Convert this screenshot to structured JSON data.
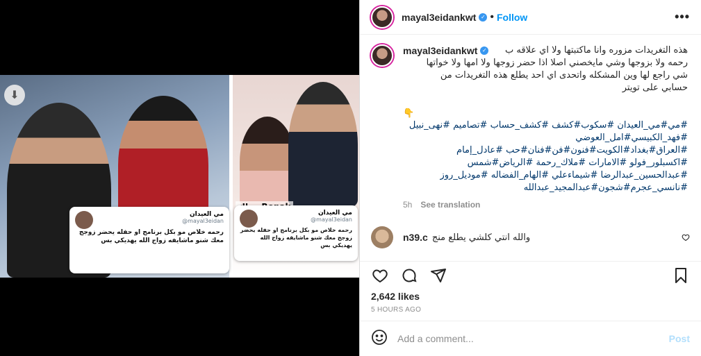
{
  "post": {
    "username": "mayal3eidankwt",
    "follow_label": "Follow",
    "dot": "•",
    "more": "•••",
    "caption_lines": [
      "هذه التغريدات مزوره وانا ماكتبتها ولا اي علاقه ب",
      "رحمه ولا بزوجها وشي مايخصني اصلا اذا حضر زوجها ولا امها ولا خواتها",
      "شي راجع لها وين المشكله واتحدى اي احد يطلع هذه التغريدات من",
      "حسابي على تويتر"
    ],
    "emoji": "👇",
    "hashtag_lines": [
      "#مي#مي_العيدان #سكوب#كشف #كشف_حساب #تصاميم #نهى_نبيل",
      "#فهد_الكبيسي#امل_العوضي",
      "#العراق#بغداد#الكويت#فنون#فن#فنان#حب #عادل_إمام",
      "#اكسبلور_فولو #الامارات #ملاك_رحمة #الرياض#شمس",
      "#عبدالحسين_عبدالرضا #شيماءعلي #الهام_الفضاله #موديل_روز",
      "#نانسي_عجرم#شجون#عبدالمجيد_عبدالله"
    ],
    "time": "5h",
    "see_translation": "See translation",
    "comment": {
      "user": "n39.c",
      "text": "والله انتي كلشي يطلع منج"
    },
    "likes": "2,642 likes",
    "ago": "5 HOURS AGO",
    "add_comment_placeholder": "Add a comment...",
    "post_label": "Post"
  },
  "media": {
    "card_left": {
      "name": "مي العيدان",
      "handle": "@mayal3eidan",
      "text": "رحمه خلاص مو بكل برنامج او حفله يحضر زوجج معك شنو ماشايفه زواج الله يهديكي بس"
    },
    "card_right": {
      "name": "مي العيدان",
      "handle": "@mayal3eidan",
      "text": "رحمه خلاص مو بكل برنامج او حفله يحضر زوجج معك شنو ماشايفه زواج الله يهديكي بس"
    },
    "brand": "روناكRonak"
  }
}
